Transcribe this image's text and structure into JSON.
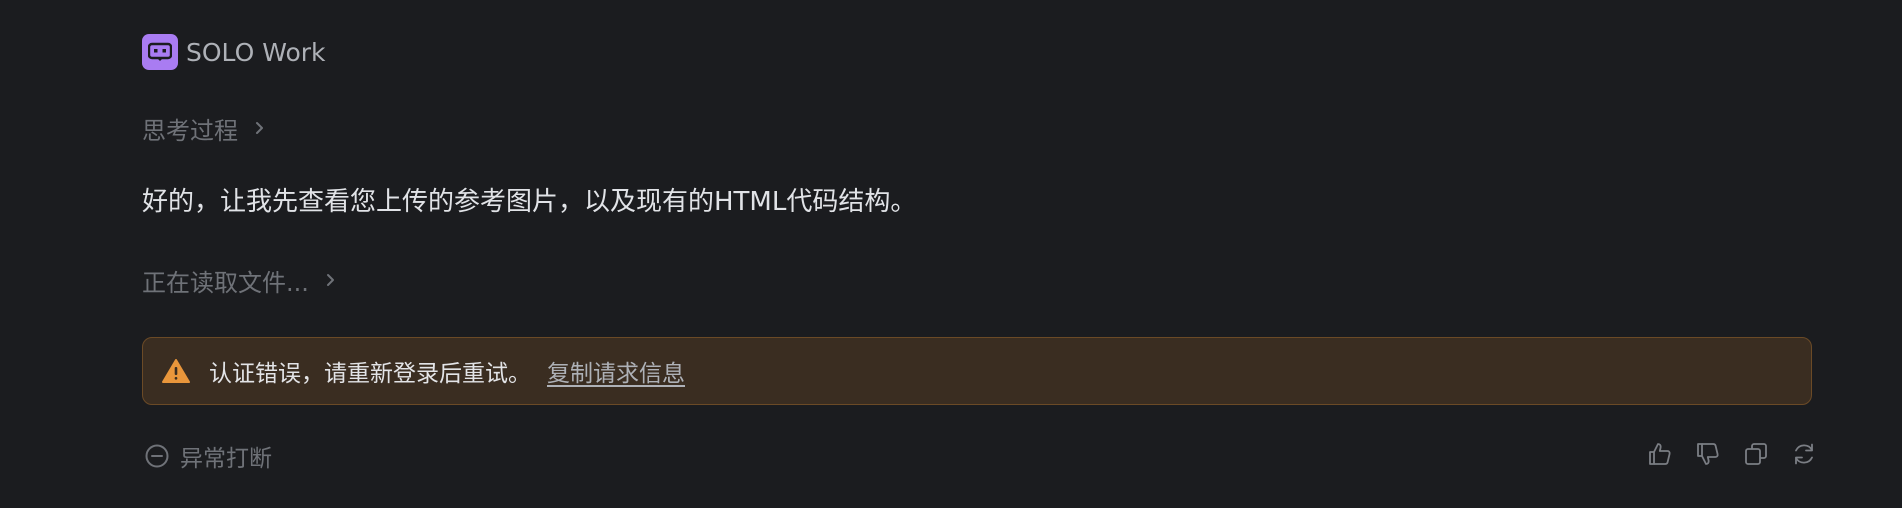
{
  "header": {
    "app_name": "SOLO Work",
    "icon": "robot-chat-icon",
    "accent": "#a97cf2"
  },
  "thinking": {
    "label": "思考过程",
    "icon": "chevron-right-icon"
  },
  "message": {
    "text": "好的，让我先查看您上传的参考图片，以及现有的HTML代码结构。"
  },
  "reading": {
    "label": "正在读取文件...",
    "icon": "chevron-right-icon"
  },
  "error": {
    "icon": "warning-icon",
    "text": "认证错误，请重新登录后重试。",
    "link_label": "复制请求信息",
    "colors": {
      "background": "#3a2d21",
      "border": "#6b4a26",
      "icon": "#e9963b"
    }
  },
  "status": {
    "icon": "minus-circle-icon",
    "label": "异常打断"
  },
  "actions": [
    {
      "icon": "thumbs-up-icon"
    },
    {
      "icon": "thumbs-down-icon"
    },
    {
      "icon": "copy-icon"
    },
    {
      "icon": "refresh-icon"
    }
  ]
}
